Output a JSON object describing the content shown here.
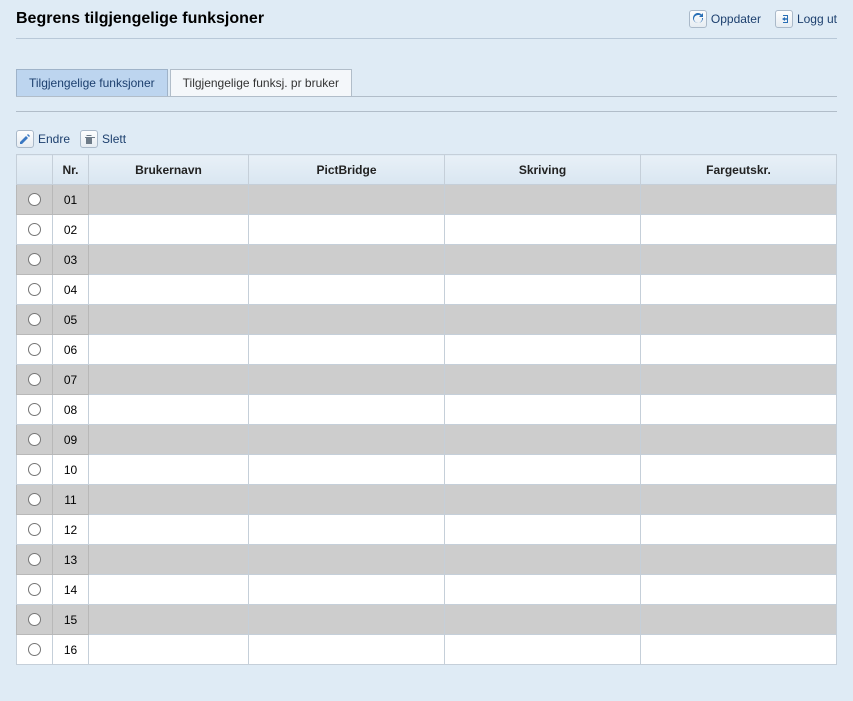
{
  "header": {
    "title": "Begrens tilgjengelige funksjoner",
    "update_label": "Oppdater",
    "logout_label": "Logg ut"
  },
  "tabs": {
    "available_functions": "Tilgjengelige funksjoner",
    "available_per_user": "Tilgjengelige funksj. pr bruker"
  },
  "toolbar": {
    "edit_label": "Endre",
    "delete_label": "Slett"
  },
  "table": {
    "headers": {
      "nr": "Nr.",
      "username": "Brukernavn",
      "pictbridge": "PictBridge",
      "printing": "Skriving",
      "colorprint": "Fargeutskr."
    },
    "rows": [
      {
        "nr": "01",
        "username": "",
        "pictbridge": "",
        "printing": "",
        "colorprint": ""
      },
      {
        "nr": "02",
        "username": "",
        "pictbridge": "",
        "printing": "",
        "colorprint": ""
      },
      {
        "nr": "03",
        "username": "",
        "pictbridge": "",
        "printing": "",
        "colorprint": ""
      },
      {
        "nr": "04",
        "username": "",
        "pictbridge": "",
        "printing": "",
        "colorprint": ""
      },
      {
        "nr": "05",
        "username": "",
        "pictbridge": "",
        "printing": "",
        "colorprint": ""
      },
      {
        "nr": "06",
        "username": "",
        "pictbridge": "",
        "printing": "",
        "colorprint": ""
      },
      {
        "nr": "07",
        "username": "",
        "pictbridge": "",
        "printing": "",
        "colorprint": ""
      },
      {
        "nr": "08",
        "username": "",
        "pictbridge": "",
        "printing": "",
        "colorprint": ""
      },
      {
        "nr": "09",
        "username": "",
        "pictbridge": "",
        "printing": "",
        "colorprint": ""
      },
      {
        "nr": "10",
        "username": "",
        "pictbridge": "",
        "printing": "",
        "colorprint": ""
      },
      {
        "nr": "11",
        "username": "",
        "pictbridge": "",
        "printing": "",
        "colorprint": ""
      },
      {
        "nr": "12",
        "username": "",
        "pictbridge": "",
        "printing": "",
        "colorprint": ""
      },
      {
        "nr": "13",
        "username": "",
        "pictbridge": "",
        "printing": "",
        "colorprint": ""
      },
      {
        "nr": "14",
        "username": "",
        "pictbridge": "",
        "printing": "",
        "colorprint": ""
      },
      {
        "nr": "15",
        "username": "",
        "pictbridge": "",
        "printing": "",
        "colorprint": ""
      },
      {
        "nr": "16",
        "username": "",
        "pictbridge": "",
        "printing": "",
        "colorprint": ""
      }
    ]
  }
}
